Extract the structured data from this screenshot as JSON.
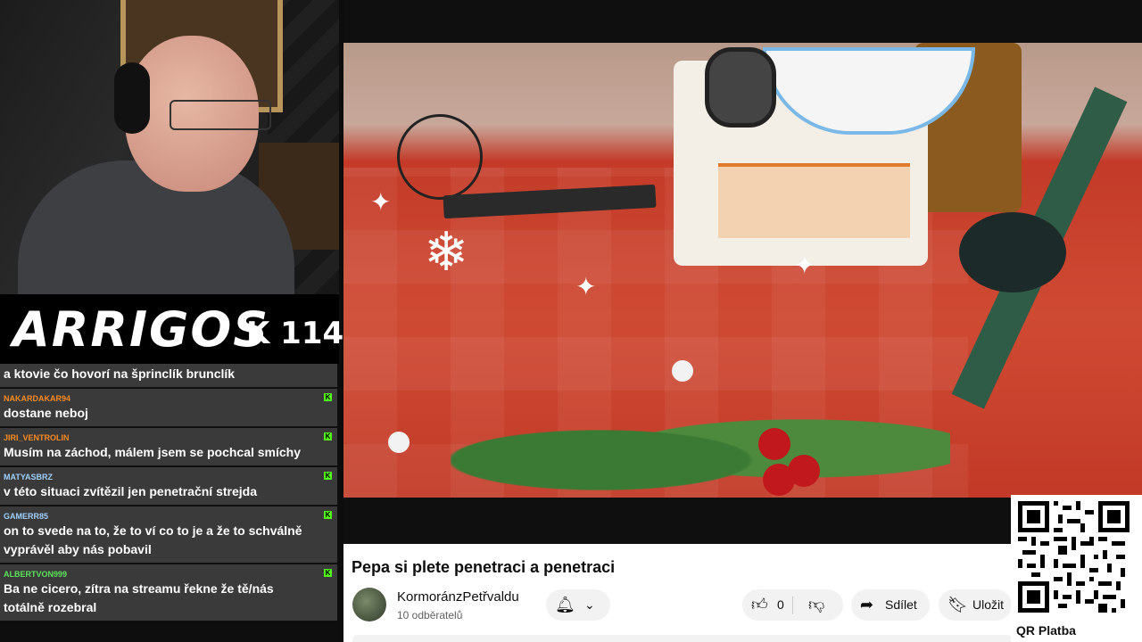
{
  "overlay": {
    "brand_logo": "ARRIGOS",
    "brand_counter": "K 114"
  },
  "chat": {
    "messages": [
      {
        "user": "",
        "text": "a ktovie čo hovorí na šprinclík brunclík",
        "user_color": "#ffb000"
      },
      {
        "user": "NAKARDAKAR94",
        "text": "dostane neboj",
        "user_color": "#ff8a1f"
      },
      {
        "user": "JIRI_VENTROLIN",
        "text": "Musím na záchod, málem jsem se pochcal smíchy",
        "user_color": "#ff8a1f"
      },
      {
        "user": "MATYASBRZ",
        "text": "v této situaci zvítězil jen penetrační strejda",
        "user_color": "#9fd0ff"
      },
      {
        "user": "GAMERR85",
        "text": "on to svede na to, že to ví co to je a že to schválně vyprávěl aby nás pobavil",
        "user_color": "#9fd0ff"
      },
      {
        "user": "ALBERTVON999",
        "text": "Ba ne cicero, zítra na streamu řekne že tě/nás totálně rozebral",
        "user_color": "#5be35b"
      }
    ],
    "platform_badge": "K",
    "badge_color": "#53fc18"
  },
  "video": {
    "title": "Pepa si plete penetraci a penetraci",
    "channel_name": "KormoránzPetřvaldu",
    "subscribers": "10 odběratelů",
    "like_count": "0",
    "share_label": "Sdílet",
    "save_label": "Uložit",
    "icons": {
      "bell": "bell-icon",
      "chevron": "chevron-down-icon",
      "like": "thumbs-up-icon",
      "dislike": "thumbs-down-icon",
      "share": "share-arrow-icon",
      "save": "bookmark-icon"
    }
  },
  "qr": {
    "label": "QR Platba"
  }
}
